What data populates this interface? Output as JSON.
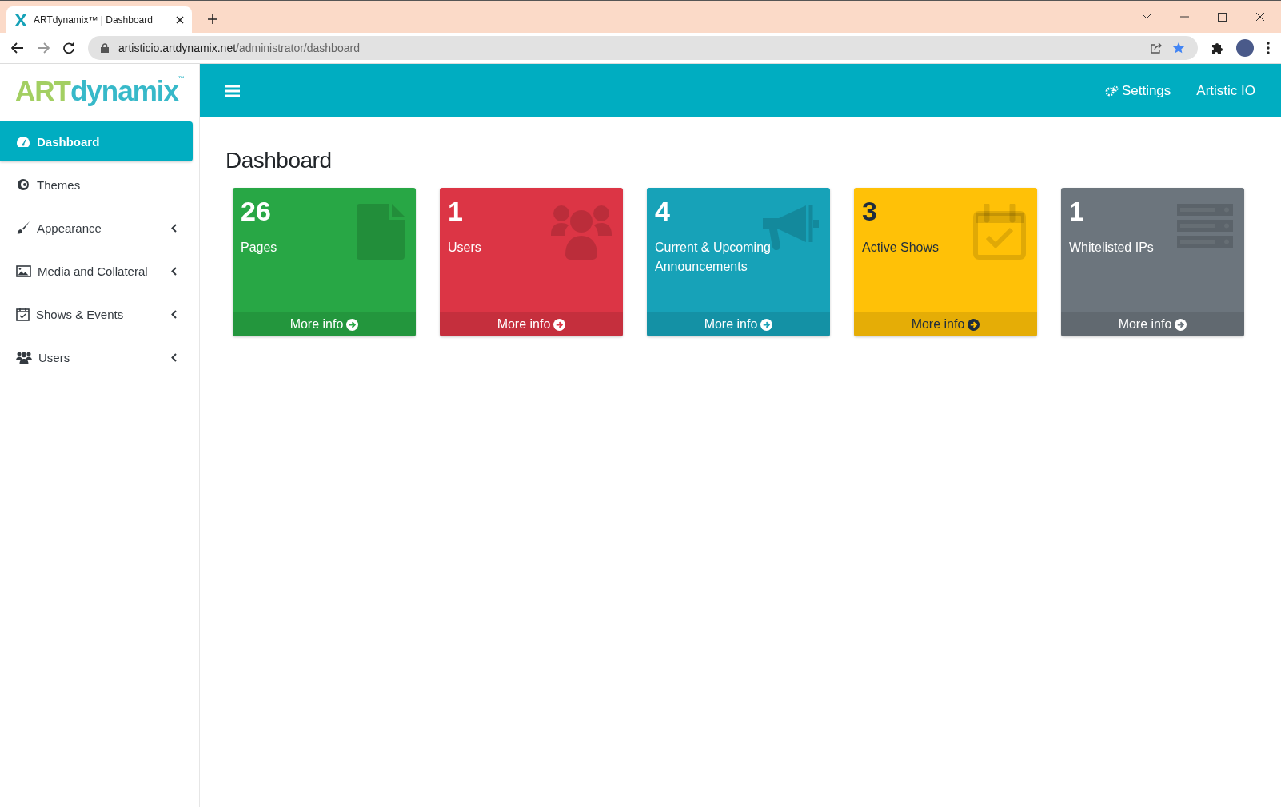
{
  "browser": {
    "tab_title": "ARTdynamix™ | Dashboard",
    "url_host": "artisticio.artdynamix.net",
    "url_path": "/administrator/dashboard"
  },
  "logo": {
    "part_1": "ART",
    "part_2": "dynamix",
    "mark": "™"
  },
  "header": {
    "settings": "Settings",
    "user": "Artistic IO"
  },
  "sidebar": {
    "items": [
      {
        "label": "Dashboard",
        "kind": "dashboard",
        "selected": true,
        "expandable": false
      },
      {
        "label": "Themes",
        "kind": "themes",
        "selected": false,
        "expandable": false
      },
      {
        "label": "Appearance",
        "kind": "brush",
        "selected": false,
        "expandable": true
      },
      {
        "label": "Media and Collateral",
        "kind": "image",
        "selected": false,
        "expandable": true
      },
      {
        "label": "Shows & Events",
        "kind": "calendar",
        "selected": false,
        "expandable": true
      },
      {
        "label": "Users",
        "kind": "users",
        "selected": false,
        "expandable": true
      }
    ]
  },
  "page_title": "Dashboard",
  "cards": [
    {
      "count": "26",
      "label": "Pages",
      "kind": "file",
      "color": "#28a745",
      "link": "More info"
    },
    {
      "count": "1",
      "label": "Users",
      "kind": "users",
      "color": "#dc3545",
      "link": "More info"
    },
    {
      "count": "4",
      "label": "Current & Upcoming Announcements",
      "kind": "megaphone",
      "color": "#17a2b8",
      "link": "More info"
    },
    {
      "count": "3",
      "label": "Active Shows",
      "kind": "calendar",
      "color": "#ffc107",
      "link": "More info"
    },
    {
      "count": "1",
      "label": "Whitelisted IPs",
      "kind": "server",
      "color": "#6c757d",
      "link": "More info"
    }
  ]
}
